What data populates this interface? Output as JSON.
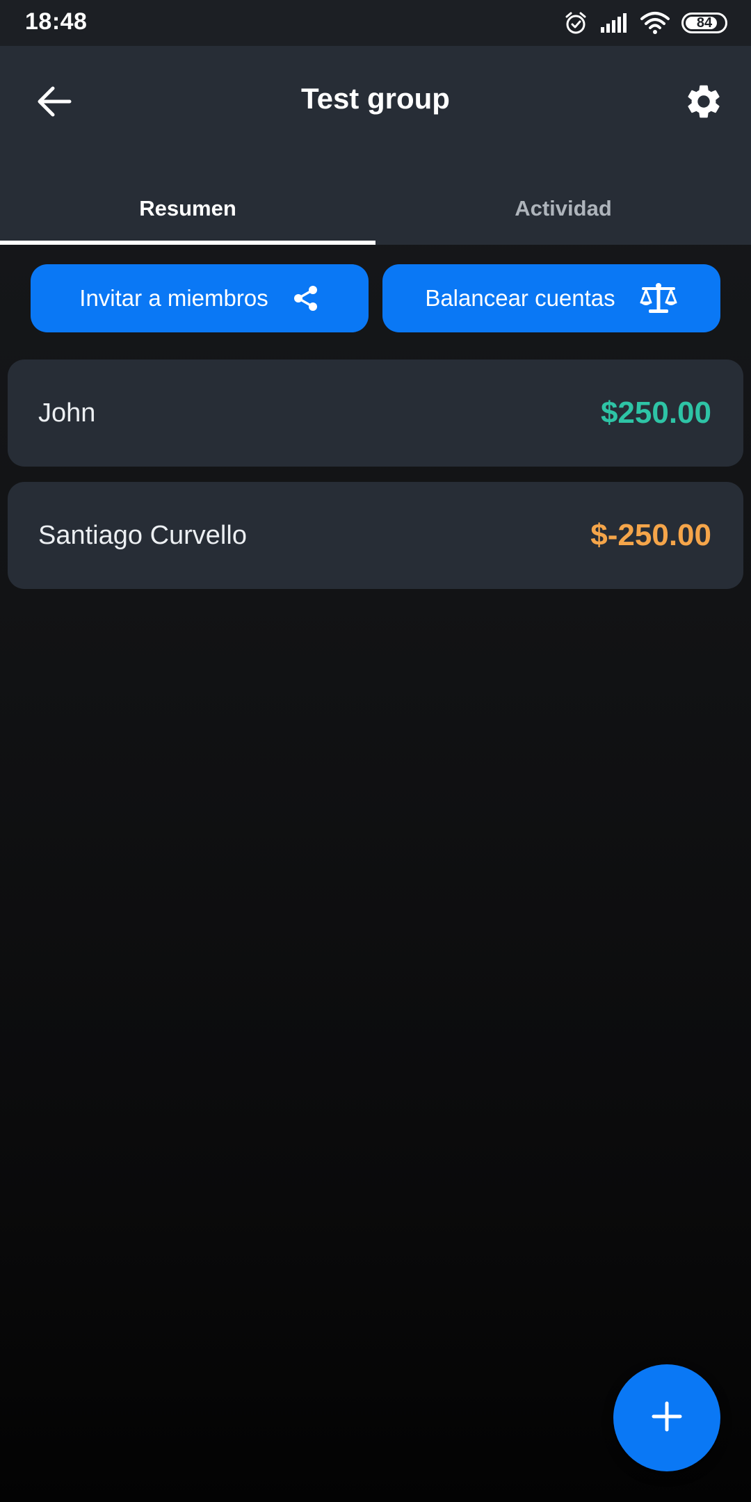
{
  "status_bar": {
    "time": "18:48",
    "battery": "84",
    "battery_level_percent": 84,
    "icons": [
      "alarm-icon",
      "signal-icon",
      "wifi-icon",
      "battery-icon"
    ]
  },
  "header": {
    "title": "Test group",
    "back_icon": "arrow-left-icon",
    "settings_icon": "gear-icon"
  },
  "tabs": [
    {
      "label": "Resumen",
      "active": true
    },
    {
      "label": "Actividad",
      "active": false
    }
  ],
  "actions": {
    "invite_label": "Invitar a miembros",
    "invite_icon": "share-icon",
    "balance_label": "Balancear cuentas",
    "balance_icon": "scale-icon"
  },
  "members": [
    {
      "name": "John",
      "amount": "$250.00",
      "status": "positive"
    },
    {
      "name": "Santiago Curvello",
      "amount": "$-250.00",
      "status": "negative"
    }
  ],
  "fab": {
    "icon": "plus-icon"
  },
  "colors": {
    "accent": "#0a78f5",
    "positive": "#2ec4a6",
    "negative": "#f5a54a",
    "surface": "#272d36",
    "status_bar": "#1c1f24"
  }
}
